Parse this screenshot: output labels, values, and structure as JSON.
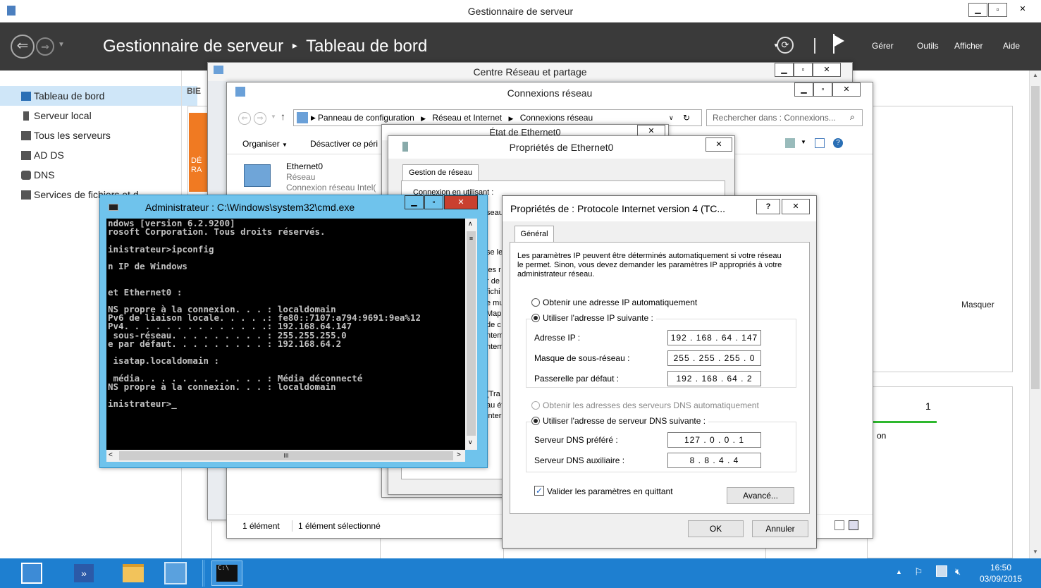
{
  "sm": {
    "title": "Gestionnaire de serveur",
    "breadcrumb_root": "Gestionnaire de serveur",
    "breadcrumb_sep": "▸",
    "breadcrumb_page": "Tableau de bord",
    "menu": [
      "Gérer",
      "Outils",
      "Afficher",
      "Aide"
    ],
    "sidebar": [
      "Tableau de bord",
      "Serveur local",
      "Tous les serveurs",
      "AD DS",
      "DNS",
      "Services de fichiers et d..."
    ],
    "section_label": "BIE",
    "tile_text": [
      "DÉ",
      "RA"
    ],
    "masquer": "Masquer",
    "count": "1",
    "bottom_text": "on"
  },
  "crp": {
    "title": "Centre Réseau et partage"
  },
  "cnx": {
    "title": "Connexions réseau",
    "path": [
      "Panneau de configuration",
      "Réseau et Internet",
      "Connexions réseau"
    ],
    "search_placeholder": "Rechercher dans : Connexions...",
    "organiser": "Organiser",
    "desactiver": "Désactiver ce péri",
    "adapter_name": "Ethernet0",
    "adapter_net": "Réseau",
    "adapter_dev": "Connexion réseau Intel(",
    "status": "1 élément",
    "status_sel": "1 élément sélectionné"
  },
  "etat": {
    "title": "État de Ethernet0"
  },
  "props": {
    "title": "Propriétés de Ethernet0",
    "tab": "Gestion de réseau",
    "conn_label": "Connexion en utilisant :",
    "partial": [
      "seau",
      "se le",
      "les r",
      "r de",
      "fichi",
      "e mu",
      "Mapp",
      "de c",
      "ntem",
      "ntem",
      "(Tra",
      "au ét",
      "inter"
    ]
  },
  "ipv4": {
    "title": "Propriétés de : Protocole Internet version 4 (TC...",
    "help": "?",
    "tab": "Général",
    "desc": "Les paramètres IP peuvent être déterminés automatiquement si votre réseau le permet. Sinon, vous devez demander les paramètres IP appropriés à votre administrateur réseau.",
    "opt_auto_ip": "Obtenir une adresse IP automatiquement",
    "opt_manual_ip": "Utiliser l'adresse IP suivante :",
    "lbl_ip": "Adresse IP :",
    "lbl_mask": "Masque de sous-réseau :",
    "lbl_gw": "Passerelle par défaut :",
    "val_ip": "192 . 168 . 64 . 147",
    "val_mask": "255 . 255 . 255 . 0",
    "val_gw": "192 . 168 . 64 . 2",
    "opt_auto_dns": "Obtenir les adresses des serveurs DNS automatiquement",
    "opt_manual_dns": "Utiliser l'adresse de serveur DNS suivante :",
    "lbl_dns1": "Serveur DNS préféré :",
    "lbl_dns2": "Serveur DNS auxiliaire :",
    "val_dns1": "127 . 0 . 0 . 1",
    "val_dns2": "8 . 8 . 4 . 4",
    "validate": "Valider les paramètres en quittant",
    "advanced": "Avancé...",
    "ok": "OK",
    "cancel": "Annuler"
  },
  "cmd": {
    "title": "Administrateur : C:\\Windows\\system32\\cmd.exe",
    "lines": [
      "ndows [version 6.2.9200]",
      "rosoft Corporation. Tous droits réservés.",
      "",
      "inistrateur>ipconfig",
      "",
      "n IP de Windows",
      "",
      "",
      "et Ethernet0 :",
      "",
      "NS propre à la connexion. . . : localdomain",
      "Pv6 de liaison locale. . . . .: fe80::7107:a794:9691:9ea%12",
      "Pv4. . . . . . . . . . . . . .: 192.168.64.147",
      " sous-réseau. . . . . . . . . : 255.255.255.0",
      "e par défaut. . . . . . . . . : 192.168.64.2",
      "",
      " isatap.localdomain :",
      "",
      " média. . . . . . . . . . . . : Média déconnecté",
      "NS propre à la connexion. . . : localdomain",
      "",
      "inistrateur>_"
    ],
    "hscroll_mark": "III"
  },
  "taskbar": {
    "time": "16:50",
    "date": "03/09/2015"
  },
  "colors": {
    "sm_header": "#3a3a3a",
    "taskbar": "#1e7fd0",
    "selected_nav": "#cfe6f8",
    "accent_green": "#2eb82e",
    "tile_orange": "#f07a22"
  }
}
